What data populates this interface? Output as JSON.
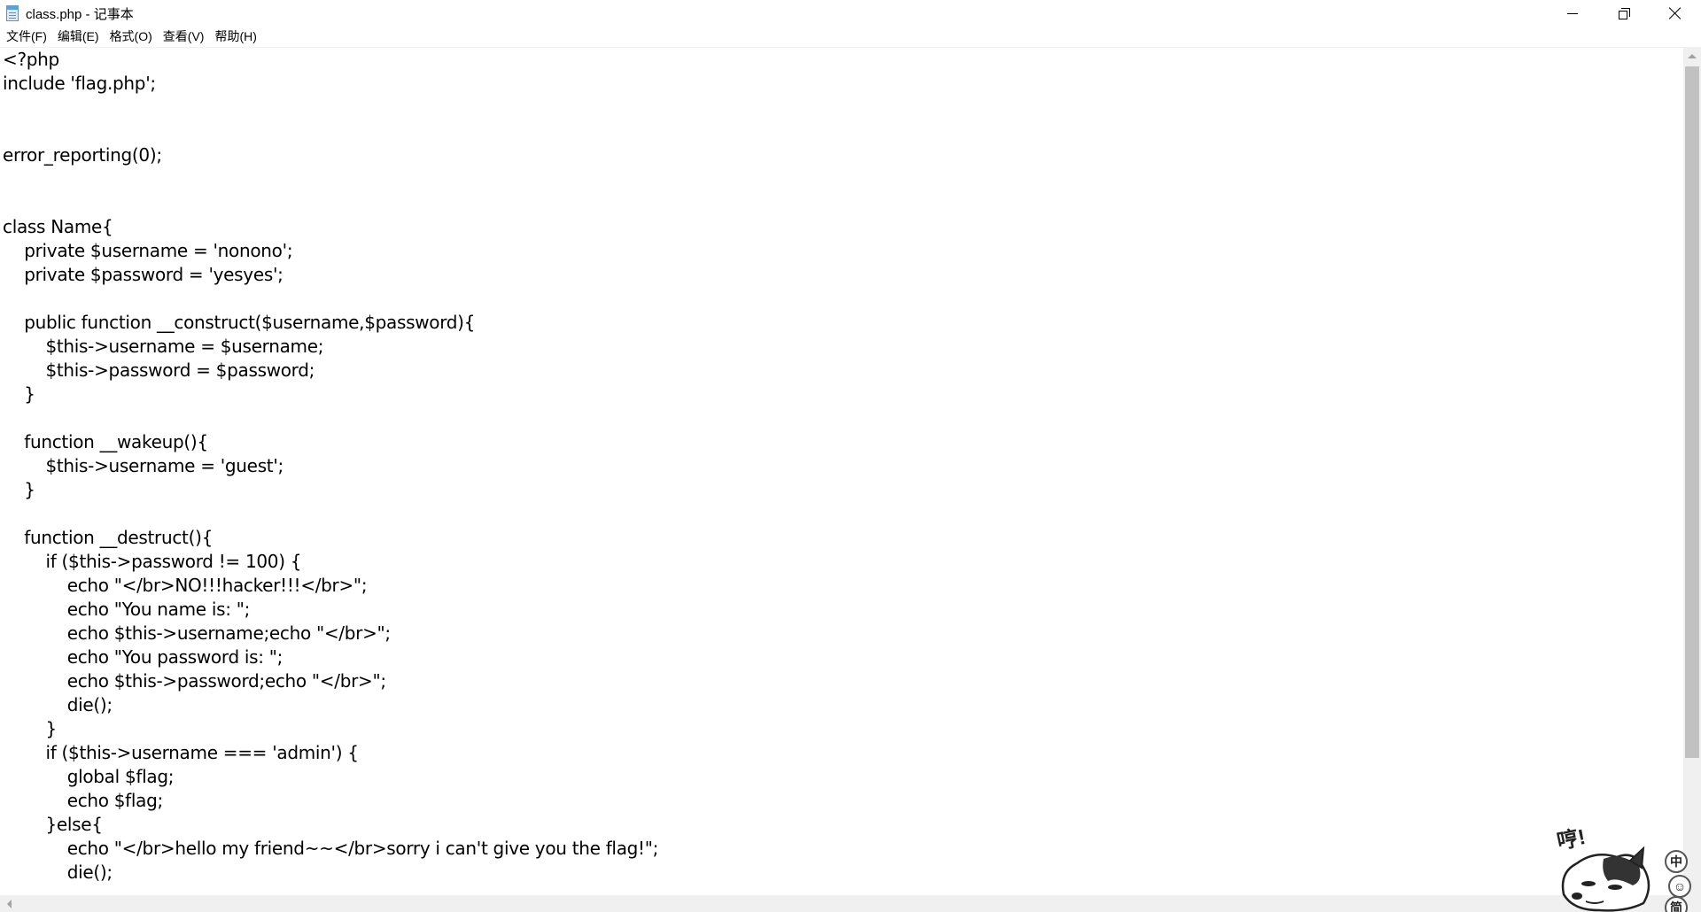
{
  "window": {
    "title": "class.php - 记事本",
    "controls": {
      "minimize": "minimize",
      "restore": "restore",
      "close": "close"
    }
  },
  "menu": [
    {
      "label": "文件(F)"
    },
    {
      "label": "编辑(E)"
    },
    {
      "label": "格式(O)"
    },
    {
      "label": "查看(V)"
    },
    {
      "label": "帮助(H)"
    }
  ],
  "editor": {
    "lines": [
      "<?php",
      "include 'flag.php';",
      "",
      "",
      "error_reporting(0);",
      "",
      "",
      "class Name{",
      "    private $username = 'nonono';",
      "    private $password = 'yesyes';",
      "",
      "    public function __construct($username,$password){",
      "        $this->username = $username;",
      "        $this->password = $password;",
      "    }",
      "",
      "    function __wakeup(){",
      "        $this->username = 'guest';",
      "    }",
      "",
      "    function __destruct(){",
      "        if ($this->password != 100) {",
      "            echo \"</br>NO!!!hacker!!!</br>\";",
      "            echo \"You name is: \";",
      "            echo $this->username;echo \"</br>\";",
      "            echo \"You password is: \";",
      "            echo $this->password;echo \"</br>\";",
      "            die();",
      "        }",
      "        if ($this->username === 'admin') {",
      "            global $flag;",
      "            echo $flag;",
      "        }else{",
      "            echo \"</br>hello my friend~~</br>sorry i can't give you the flag!\";",
      "            die();"
    ]
  },
  "ime": {
    "speech": "哼!",
    "buttons": [
      "中",
      "☺",
      "简"
    ]
  },
  "icons": {
    "app": "notepad-icon",
    "minimize": "minimize-icon",
    "restore": "restore-icon",
    "close": "close-icon",
    "mascot": "husky-mascot-icon"
  }
}
